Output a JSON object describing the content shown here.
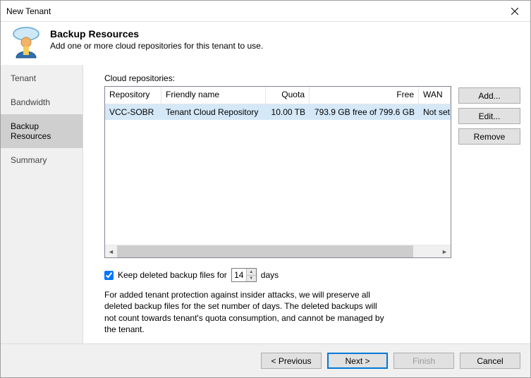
{
  "window": {
    "title": "New Tenant"
  },
  "header": {
    "title": "Backup Resources",
    "subtitle": "Add one or more cloud repositories for this tenant to use."
  },
  "sidebar": {
    "items": [
      {
        "label": "Tenant"
      },
      {
        "label": "Bandwidth"
      },
      {
        "label": "Backup Resources"
      },
      {
        "label": "Summary"
      }
    ],
    "selected_index": 2
  },
  "main": {
    "repos_label": "Cloud repositories:",
    "columns": {
      "repository": "Repository",
      "friendly": "Friendly name",
      "quota": "Quota",
      "free": "Free",
      "wan": "WAN"
    },
    "rows": [
      {
        "repository": "VCC-SOBR",
        "friendly": "Tenant Cloud Repository",
        "quota": "10.00 TB",
        "free": "793.9 GB free of 799.6 GB",
        "wan": "Not set"
      }
    ],
    "buttons": {
      "add": "Add...",
      "edit": "Edit...",
      "remove": "Remove"
    },
    "option": {
      "checkbox_label_prefix": "Keep deleted backup files for",
      "days_value": "14",
      "checkbox_label_suffix": "days",
      "help": "For added tenant protection against insider attacks, we will preserve all deleted backup files for the set number of days. The deleted backups will not count towards tenant's quota consumption, and cannot be managed by the tenant."
    }
  },
  "footer": {
    "previous": "< Previous",
    "next": "Next >",
    "finish": "Finish",
    "cancel": "Cancel"
  }
}
